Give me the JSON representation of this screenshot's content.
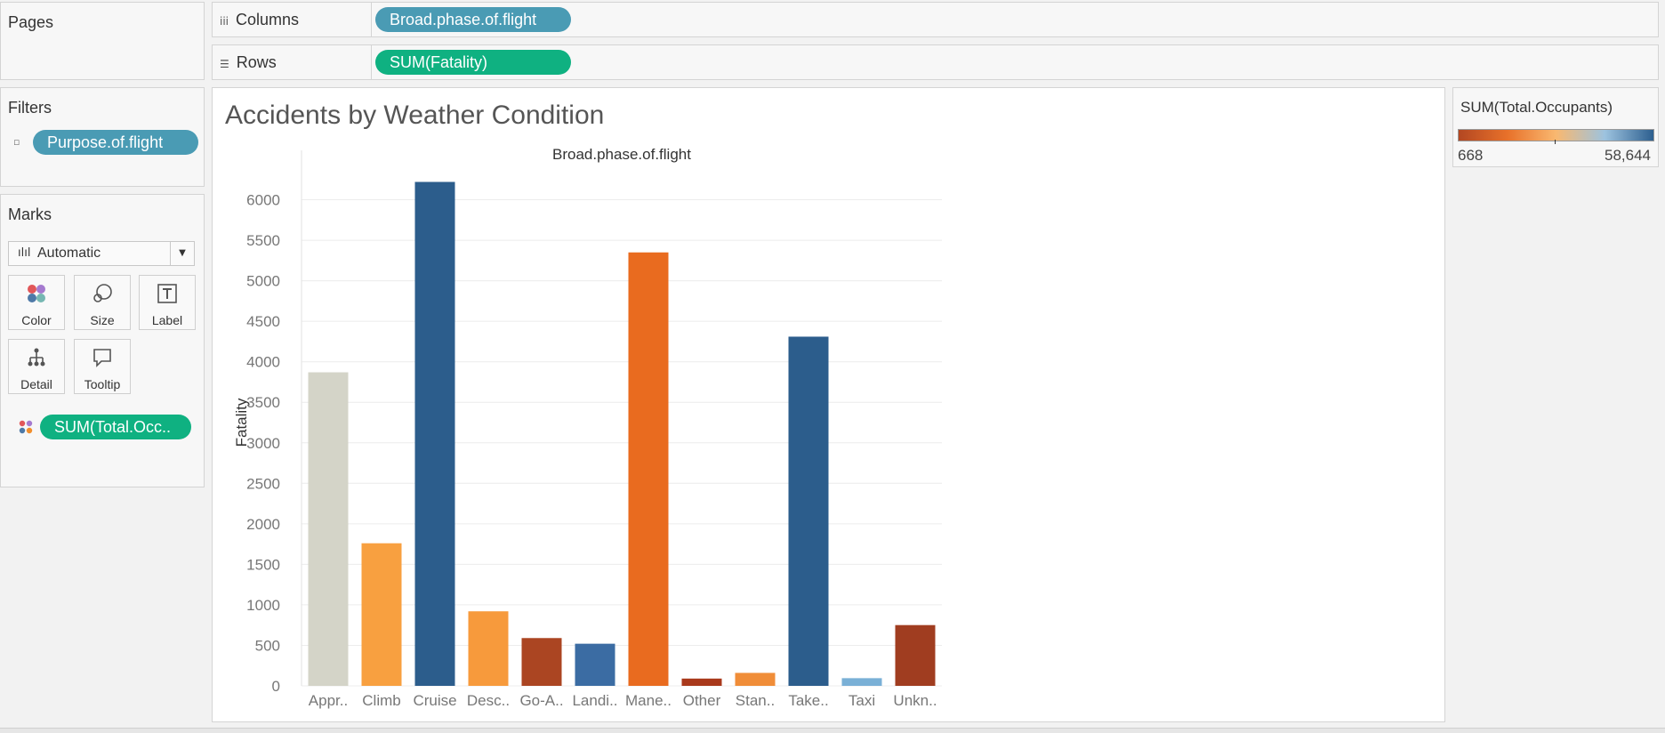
{
  "pages": {
    "title": "Pages"
  },
  "columns_shelf": {
    "label": "Columns",
    "pill": "Broad.phase.of.flight"
  },
  "rows_shelf": {
    "label": "Rows",
    "pill": "SUM(Fatality)"
  },
  "filters": {
    "title": "Filters",
    "pill": "Purpose.of.flight"
  },
  "marks": {
    "title": "Marks",
    "type": "Automatic",
    "buttons": [
      {
        "label": "Color",
        "icon": "color-dots-icon"
      },
      {
        "label": "Size",
        "icon": "size-circles-icon"
      },
      {
        "label": "Label",
        "icon": "label-t-icon"
      },
      {
        "label": "Detail",
        "icon": "detail-tree-icon"
      },
      {
        "label": "Tooltip",
        "icon": "tooltip-bubble-icon"
      }
    ],
    "color_pill": "SUM(Total.Occ.."
  },
  "legend": {
    "title": "SUM(Total.Occupants)",
    "min": "668",
    "max": "58,644",
    "colors": [
      "#b34722",
      "#e8712a",
      "#f9b870",
      "#9dc3df",
      "#2d5f8f"
    ]
  },
  "chart_data": {
    "type": "bar",
    "title": "Accidents by Weather Condition",
    "column_header": "Broad.phase.of.flight",
    "ylabel": "Fatality",
    "categories": [
      "Appr..",
      "Climb",
      "Cruise",
      "Desc..",
      "Go-A..",
      "Landi..",
      "Mane..",
      "Other",
      "Stan..",
      "Take..",
      "Taxi",
      "Unkn.."
    ],
    "values": [
      3870,
      1760,
      6220,
      920,
      590,
      520,
      5350,
      90,
      160,
      4310,
      95,
      750
    ],
    "colors": [
      "#d4d4c8",
      "#f8a040",
      "#2c5d8c",
      "#f79a3c",
      "#ab4522",
      "#3b6ca3",
      "#e96b1f",
      "#a9391c",
      "#f08d38",
      "#2c5d8c",
      "#7ab0d6",
      "#a03d20"
    ],
    "ylim": [
      0,
      6500
    ],
    "yticks": [
      0,
      500,
      1000,
      1500,
      2000,
      2500,
      3000,
      3500,
      4000,
      4500,
      5000,
      5500,
      6000
    ],
    "grid": true
  }
}
